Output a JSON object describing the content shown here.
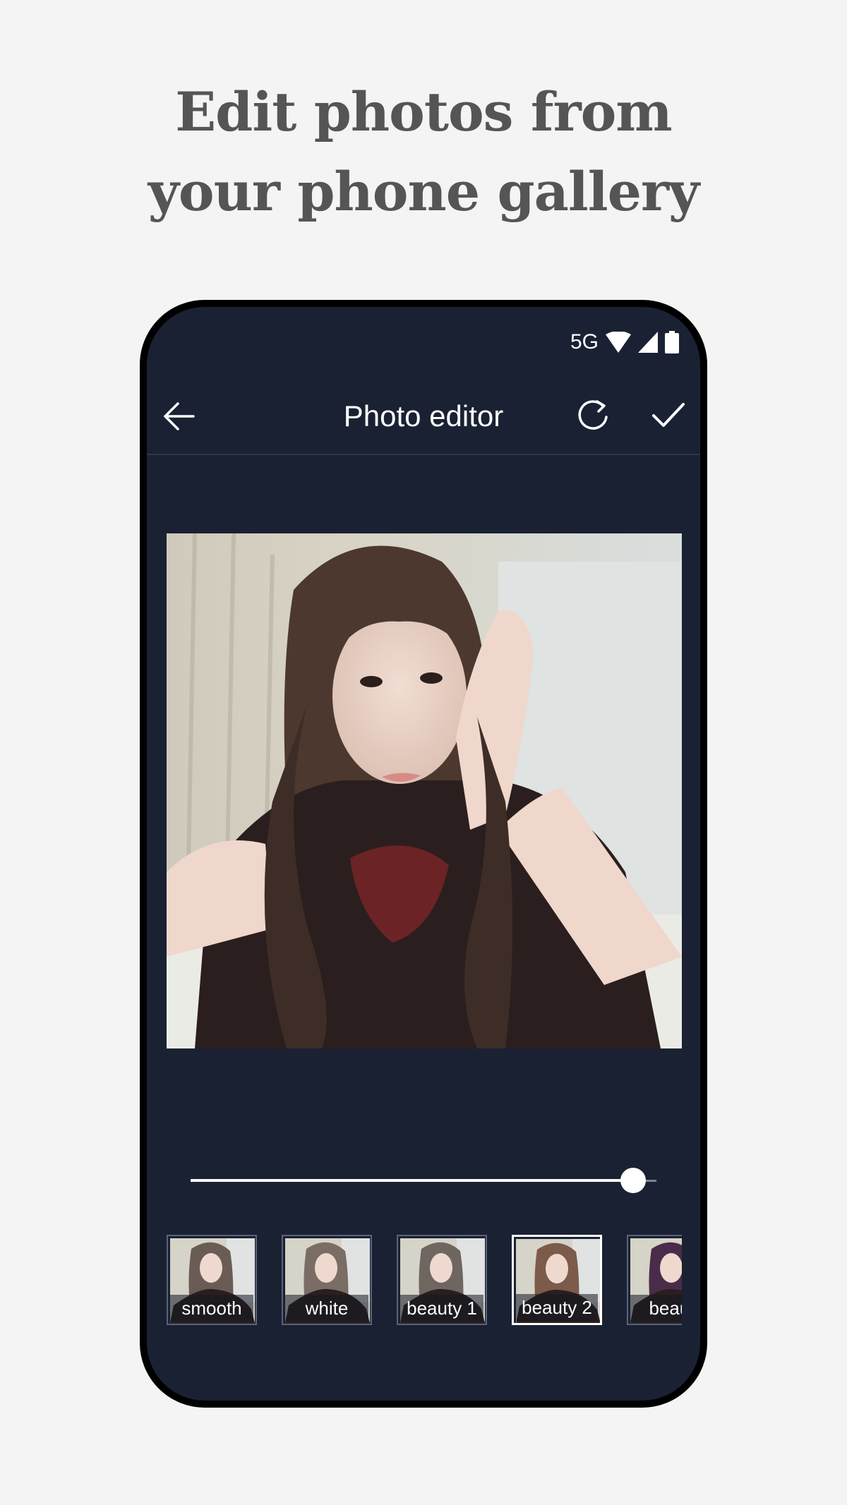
{
  "promo": {
    "headline_line1": "Edit photos from",
    "headline_line2": "your phone gallery"
  },
  "status_bar": {
    "network": "5G",
    "icons": [
      "wifi-icon",
      "signal-icon",
      "battery-icon"
    ]
  },
  "app_bar": {
    "title": "Photo editor",
    "back_icon": "arrow-left-icon",
    "reset_icon": "refresh-icon",
    "confirm_icon": "checkmark-icon"
  },
  "editor": {
    "intensity": 0.95
  },
  "filters": [
    {
      "label": "smooth",
      "selected": false
    },
    {
      "label": "white",
      "selected": false
    },
    {
      "label": "beauty 1",
      "selected": false
    },
    {
      "label": "beauty 2",
      "selected": true
    },
    {
      "label": "beaut",
      "selected": false
    }
  ],
  "colors": {
    "page_background": "#f4f4f4",
    "headline": "#555555",
    "screen_background": "#1a2133",
    "accent": "#ffffff"
  }
}
